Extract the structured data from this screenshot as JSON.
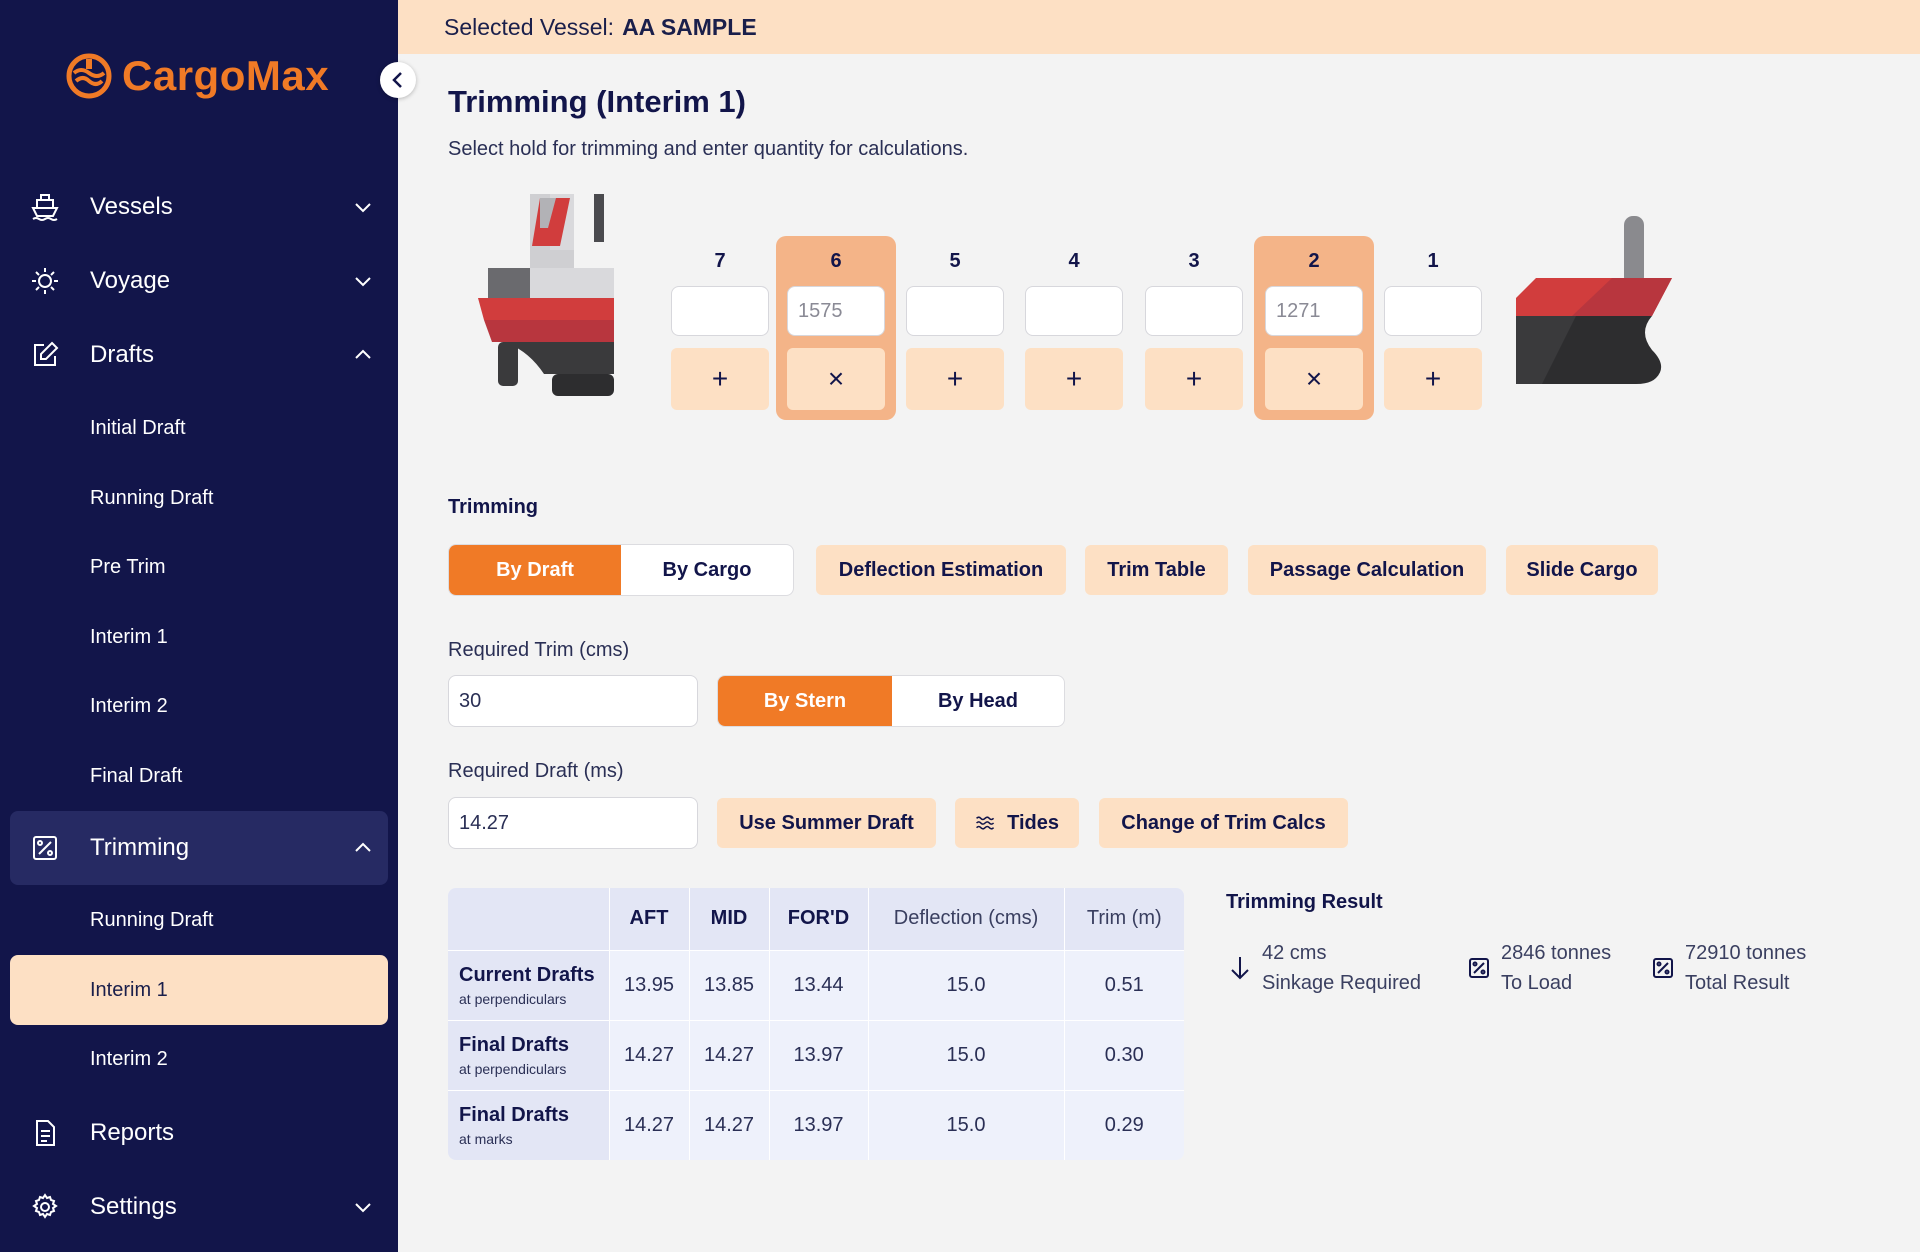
{
  "app": {
    "name": "CargoMax"
  },
  "topbar": {
    "prefix": "Selected Vessel:",
    "vessel": "AA SAMPLE"
  },
  "sidebar": {
    "groups": [
      {
        "label": "Vessels",
        "icon": "ship-icon"
      },
      {
        "label": "Voyage",
        "icon": "sun-gear-icon"
      },
      {
        "label": "Drafts",
        "icon": "edit-icon"
      },
      {
        "label": "Trimming",
        "icon": "percent-chart-icon"
      },
      {
        "label": "Reports",
        "icon": "document-icon"
      },
      {
        "label": "Settings",
        "icon": "gear-icon"
      }
    ],
    "drafts_items": [
      "Initial Draft",
      "Running Draft",
      "Pre Trim",
      "Interim 1",
      "Interim 2",
      "Final Draft"
    ],
    "trimming_items": [
      "Running Draft",
      "Interim 1",
      "Interim 2"
    ],
    "selected_item": "Interim 1"
  },
  "page": {
    "title": "Trimming (Interim 1)",
    "subtitle": "Select hold for trimming and enter quantity for calculations."
  },
  "holds": [
    {
      "num": "7",
      "value": "",
      "active": false,
      "action": "+"
    },
    {
      "num": "6",
      "value": "1575",
      "active": true,
      "action": "×"
    },
    {
      "num": "5",
      "value": "",
      "active": false,
      "action": "+"
    },
    {
      "num": "4",
      "value": "",
      "active": false,
      "action": "+"
    },
    {
      "num": "3",
      "value": "",
      "active": false,
      "action": "+"
    },
    {
      "num": "2",
      "value": "1271",
      "active": true,
      "action": "×"
    },
    {
      "num": "1",
      "value": "",
      "active": false,
      "action": "+"
    }
  ],
  "trimming": {
    "section_label": "Trimming",
    "mode_tabs": [
      "By Draft",
      "By Cargo"
    ],
    "active_mode": "By Draft",
    "tools": [
      "Deflection Estimation",
      "Trim Table",
      "Passage Calculation",
      "Slide Cargo"
    ],
    "required_trim_label": "Required Trim (cms)",
    "required_trim_value": "30",
    "trim_dir_tabs": [
      "By Stern",
      "By Head"
    ],
    "active_trim_dir": "By Stern",
    "required_draft_label": "Required Draft (ms)",
    "required_draft_value": "14.27",
    "draft_buttons": [
      "Use Summer Draft",
      "Tides",
      "Change of Trim Calcs"
    ]
  },
  "table": {
    "headers": [
      "",
      "AFT",
      "MID",
      "FOR'D",
      "Deflection (cms)",
      "Trim (m)"
    ],
    "rows": [
      {
        "title": "Current Drafts",
        "sub": "at perpendiculars",
        "aft": "13.95",
        "mid": "13.85",
        "ford": "13.44",
        "deflection": "15.0",
        "trim": "0.51"
      },
      {
        "title": "Final Drafts",
        "sub": "at perpendiculars",
        "aft": "14.27",
        "mid": "14.27",
        "ford": "13.97",
        "deflection": "15.0",
        "trim": "0.30"
      },
      {
        "title": "Final Drafts",
        "sub": "at marks",
        "aft": "14.27",
        "mid": "14.27",
        "ford": "13.97",
        "deflection": "15.0",
        "trim": "0.29"
      }
    ]
  },
  "result": {
    "title": "Trimming Result",
    "items": [
      {
        "value": "42 cms",
        "label": "Sinkage Required",
        "icon": "arrow-down-icon"
      },
      {
        "value": "2846 tonnes",
        "label": "To Load",
        "icon": "percent-box-icon"
      },
      {
        "value": "72910 tonnes",
        "label": "Total Result",
        "icon": "percent-box-icon"
      }
    ]
  },
  "colors": {
    "sidebar": "#12154a",
    "accent": "#f07a26",
    "peach": "#fde0c4",
    "hold_active": "#f4b488"
  }
}
